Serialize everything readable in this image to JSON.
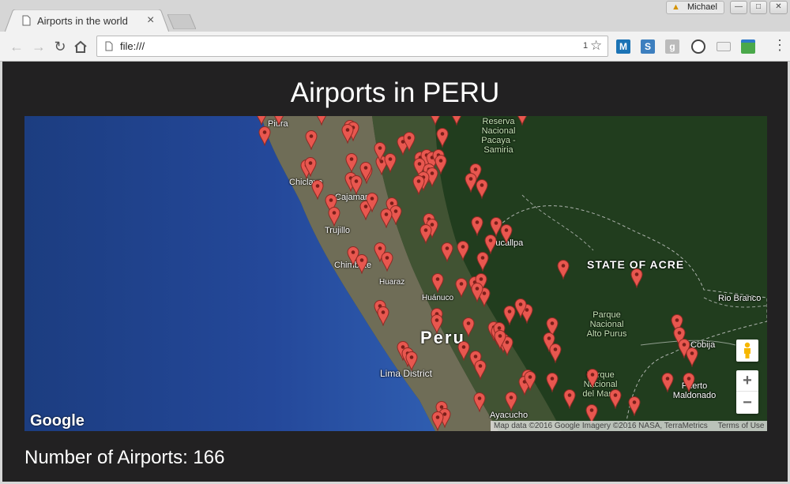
{
  "browser": {
    "tab_title": "Airports in the world",
    "tab_close": "×",
    "url": "file:///",
    "url_tail": "1",
    "profile_name": "Michael",
    "profile_warning": "▲",
    "colors": {
      "toolbar": "#f2f2f2",
      "tab": "#f2f2f2",
      "frame": "#d6d6d6"
    },
    "extensions": [
      "m-extension-icon",
      "s-extension-icon",
      "google-plus-extension-icon",
      "gear-extension-icon",
      "folder-extension-icon",
      "screen-extension-icon"
    ]
  },
  "page": {
    "title": "Airports in PERU",
    "count_label": "Number of Airports: 166",
    "background": "#222122"
  },
  "map": {
    "country_label": "Peru",
    "state_label": "STATE OF ACRE",
    "cities": [
      {
        "name": "Piura"
      },
      {
        "name": "Chiclayo"
      },
      {
        "name": "Cajamarca"
      },
      {
        "name": "Trujillo"
      },
      {
        "name": "Chimbote"
      },
      {
        "name": "Huaraz"
      },
      {
        "name": "Huánuco"
      },
      {
        "name": "Pucallpa"
      },
      {
        "name": "Lima District"
      },
      {
        "name": "Ayacucho"
      },
      {
        "name": "Rio Branco"
      },
      {
        "name": "Cobija"
      },
      {
        "name": "Puerto Maldonado"
      }
    ],
    "parks": [
      {
        "name": "Reserva Nacional Pacaya - Samiria"
      },
      {
        "name": "Parque Nacional Alto Purus"
      },
      {
        "name": "Parque Nacional del Manu"
      }
    ],
    "logo": "Google",
    "attribution": "Map data ©2016 Google Imagery ©2016 NASA, TerraMetrics",
    "terms": "Terms of Use",
    "zoom_in": "+",
    "zoom_out": "−",
    "marker_color": "#e8574f",
    "marker_count_visible": 120
  }
}
